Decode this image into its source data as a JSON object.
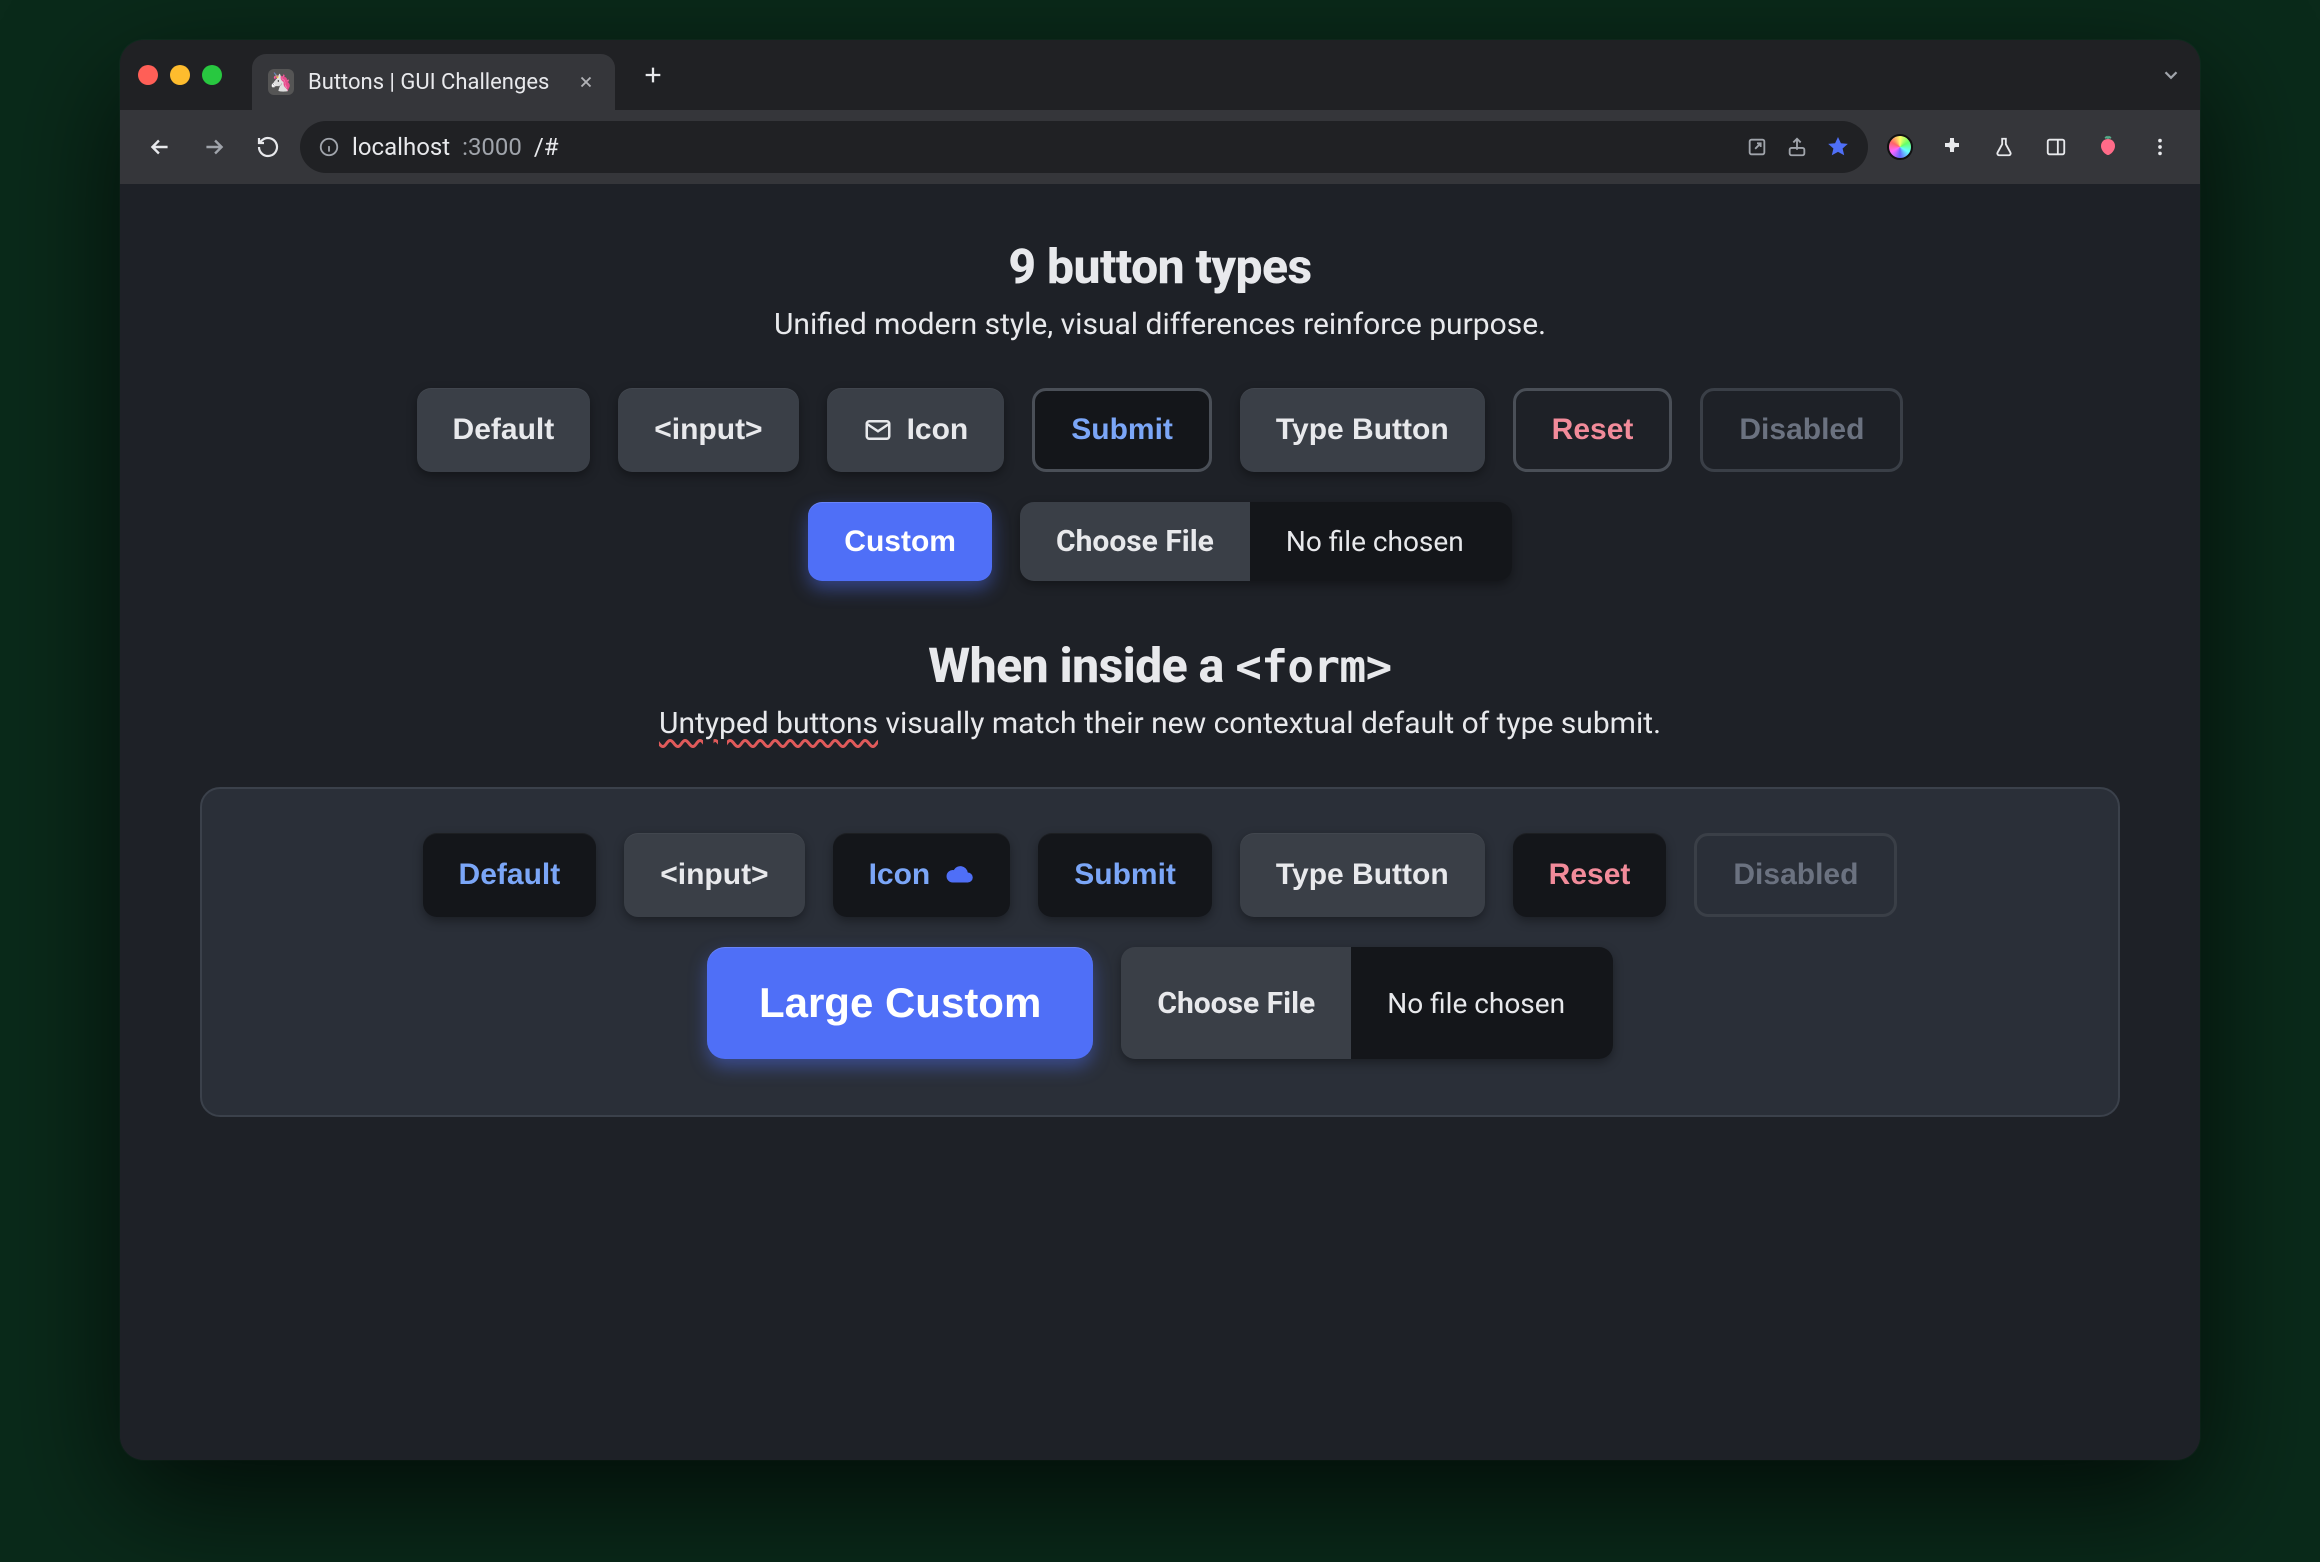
{
  "browser": {
    "tab_title": "Buttons | GUI Challenges",
    "url_host": "localhost",
    "url_port": ":3000",
    "url_path": "/#"
  },
  "section1": {
    "title": "9 button types",
    "subtitle": "Unified modern style, visual differences reinforce purpose.",
    "buttons": {
      "default": "Default",
      "input": "<input>",
      "icon": "Icon",
      "submit": "Submit",
      "type_button": "Type Button",
      "reset": "Reset",
      "disabled": "Disabled",
      "custom": "Custom",
      "choose_file": "Choose File",
      "no_file": "No file chosen"
    }
  },
  "section2": {
    "title_prefix": "When inside a ",
    "title_code": "<form>",
    "subtitle_wavy": "Untyped buttons",
    "subtitle_rest": " visually match their new contextual default of type submit.",
    "buttons": {
      "default": "Default",
      "input": "<input>",
      "icon": "Icon",
      "submit": "Submit",
      "type_button": "Type Button",
      "reset": "Reset",
      "disabled": "Disabled",
      "large_custom": "Large Custom",
      "choose_file": "Choose File",
      "no_file": "No file chosen"
    }
  },
  "colors": {
    "custom_button": "#4f6ff7",
    "submit_text": "#7ba6f7",
    "reset_text": "#f28b9a"
  }
}
